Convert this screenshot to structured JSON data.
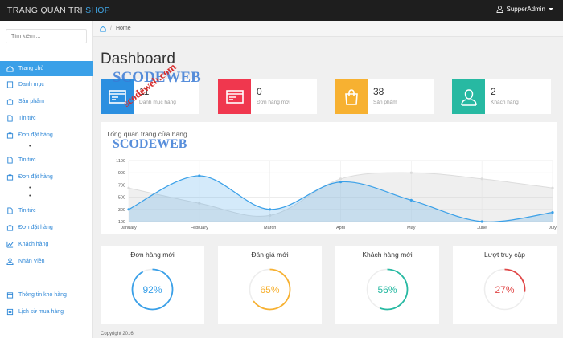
{
  "brand": {
    "main": "TRANG QUẢN TRỊ",
    "suffix": "SHOP"
  },
  "user": {
    "name": "SupperAdmin"
  },
  "search": {
    "placeholder": "Tìm kiếm ..."
  },
  "nav": {
    "home": "Trang chủ",
    "category": "Danh mục",
    "product": "Sản phẩm",
    "news1": "Tin tức",
    "orders1": "Đơn đặt hàng",
    "news2": "Tin tức",
    "orders2": "Đơn đặt hàng",
    "news3": "Tin tức",
    "orders3": "Đơn đặt hàng",
    "customers": "Khách hàng",
    "staff": "Nhân Viên",
    "warehouse": "Thông tin kho hàng",
    "history": "Lịch sử mua hàng",
    "sub_bullet": "•"
  },
  "breadcrumb": {
    "home": "Home"
  },
  "page": {
    "title": "Dashboard"
  },
  "stats": [
    {
      "value": "11",
      "label": "Danh mục hàng",
      "color": "#2b8fe0"
    },
    {
      "value": "0",
      "label": "Đơn hàng mới",
      "color": "#f0374e"
    },
    {
      "value": "38",
      "label": "Sản phẩm",
      "color": "#f7b131"
    },
    {
      "value": "2",
      "label": "Khách hàng",
      "color": "#27b9a2"
    }
  ],
  "panel": {
    "title": "Tổng quan trang cửa hàng"
  },
  "chart_data": {
    "type": "area",
    "categories": [
      "January",
      "February",
      "March",
      "April",
      "May",
      "June",
      "July"
    ],
    "yticks": [
      100,
      300,
      500,
      700,
      900,
      1100
    ],
    "ylim": [
      100,
      1100
    ],
    "series": [
      {
        "values": [
          650,
          400,
          200,
          800,
          900,
          800,
          650
        ],
        "color": "#dcdcdc"
      },
      {
        "values": [
          300,
          850,
          300,
          750,
          450,
          100,
          250
        ],
        "color": "#3aa0e8"
      }
    ]
  },
  "circles": [
    {
      "title": "Đơn hàng mới",
      "percent": "92%",
      "value": 92,
      "color": "#3aa0e8"
    },
    {
      "title": "Đán giá mới",
      "percent": "65%",
      "value": 65,
      "color": "#f7b131"
    },
    {
      "title": "Khách hàng mới",
      "percent": "56%",
      "value": 56,
      "color": "#27b9a2"
    },
    {
      "title": "Lượt truy cập",
      "percent": "27%",
      "value": 27,
      "color": "#e04646"
    }
  ],
  "footer": {
    "text": "Copyright 2016"
  },
  "watermarks": [
    "SCODEWEB",
    "scodeweb.com",
    "SCODEWEB"
  ]
}
